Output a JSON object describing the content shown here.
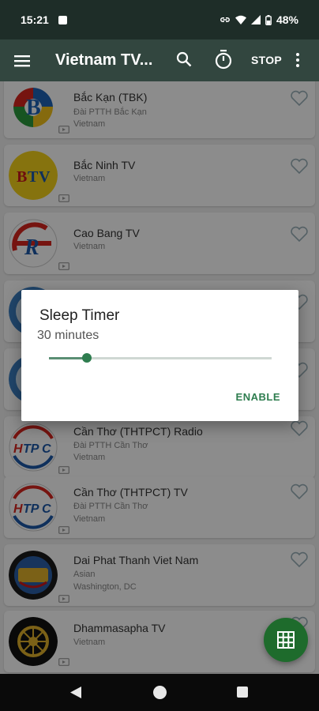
{
  "status": {
    "time": "15:21",
    "battery": "48%"
  },
  "app_bar": {
    "title": "Vietnam TV...",
    "stop_label": "STOP"
  },
  "stations": [
    {
      "name": "Bắc Kạn (TBK)",
      "lines": [
        "Đài PTTH Bắc Kạn",
        "Vietnam"
      ]
    },
    {
      "name": "Bắc Ninh TV",
      "lines": [
        "Vietnam"
      ]
    },
    {
      "name": "Cao Bang TV",
      "lines": [
        "Vietnam"
      ]
    },
    {
      "name": "",
      "lines": []
    },
    {
      "name": "",
      "lines": []
    },
    {
      "name": "Cần Thơ (THTPCT) Radio",
      "lines": [
        "Đài PTTH Cần Thơ",
        "Vietnam"
      ]
    },
    {
      "name": "Cần Thơ (THTPCT) TV",
      "lines": [
        "Đài PTTH Cần Thơ",
        "Vietnam"
      ]
    },
    {
      "name": "Dai Phat Thanh Viet Nam",
      "lines": [
        "Asian",
        "Washington, DC"
      ]
    },
    {
      "name": "Dhammasapha TV",
      "lines": [
        "Vietnam"
      ]
    }
  ],
  "dialog": {
    "title": "Sleep Timer",
    "value": "30 minutes",
    "slider_fraction": 0.17,
    "enable_label": "ENABLE"
  },
  "colors": {
    "status_bar": "#1e2d28",
    "app_bar": "#32463f",
    "accent": "#2e7d4f",
    "fab": "#1e6b2c"
  }
}
